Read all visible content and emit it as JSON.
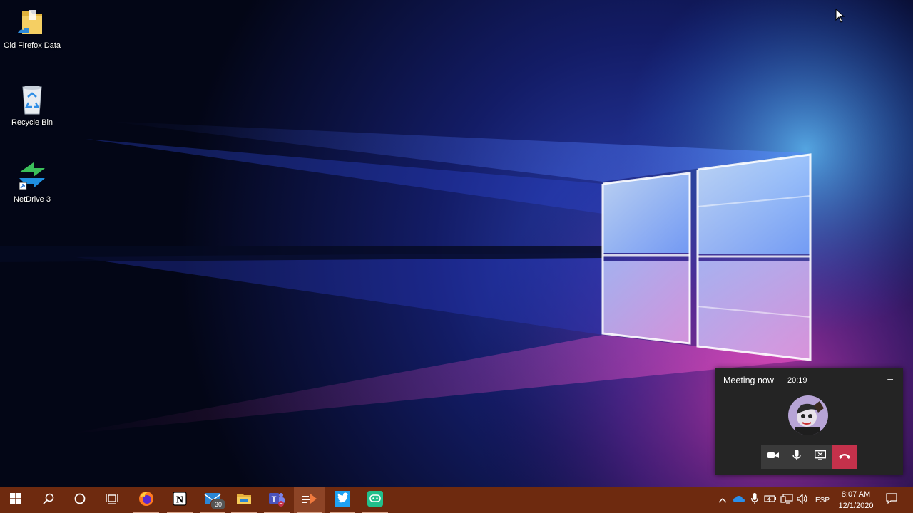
{
  "desktop": {
    "icons": [
      {
        "label": "Old Firefox Data",
        "icon": "folder-icon"
      },
      {
        "label": "Recycle Bin",
        "icon": "recycle-bin-icon"
      },
      {
        "label": "NetDrive 3",
        "icon": "netdrive-icon"
      }
    ]
  },
  "meeting": {
    "title": "Meeting now",
    "timer": "20:19",
    "minimize_label": "–"
  },
  "taskbar": {
    "mail_badge": "30",
    "pinned": [
      "windows-start-icon",
      "search-icon",
      "cortana-icon",
      "task-view-icon",
      "firefox-icon",
      "notion-icon",
      "mail-icon",
      "file-explorer-icon",
      "teams-icon",
      "meeting-app-icon",
      "twitter-icon",
      "chat-app-icon"
    ],
    "tray": {
      "language": "ESP",
      "time": "8:07 AM",
      "date": "12/1/2020"
    }
  },
  "colors": {
    "taskbar": "#6e2a0f",
    "hangup": "#c4314b",
    "meeting_bg": "#242424"
  }
}
